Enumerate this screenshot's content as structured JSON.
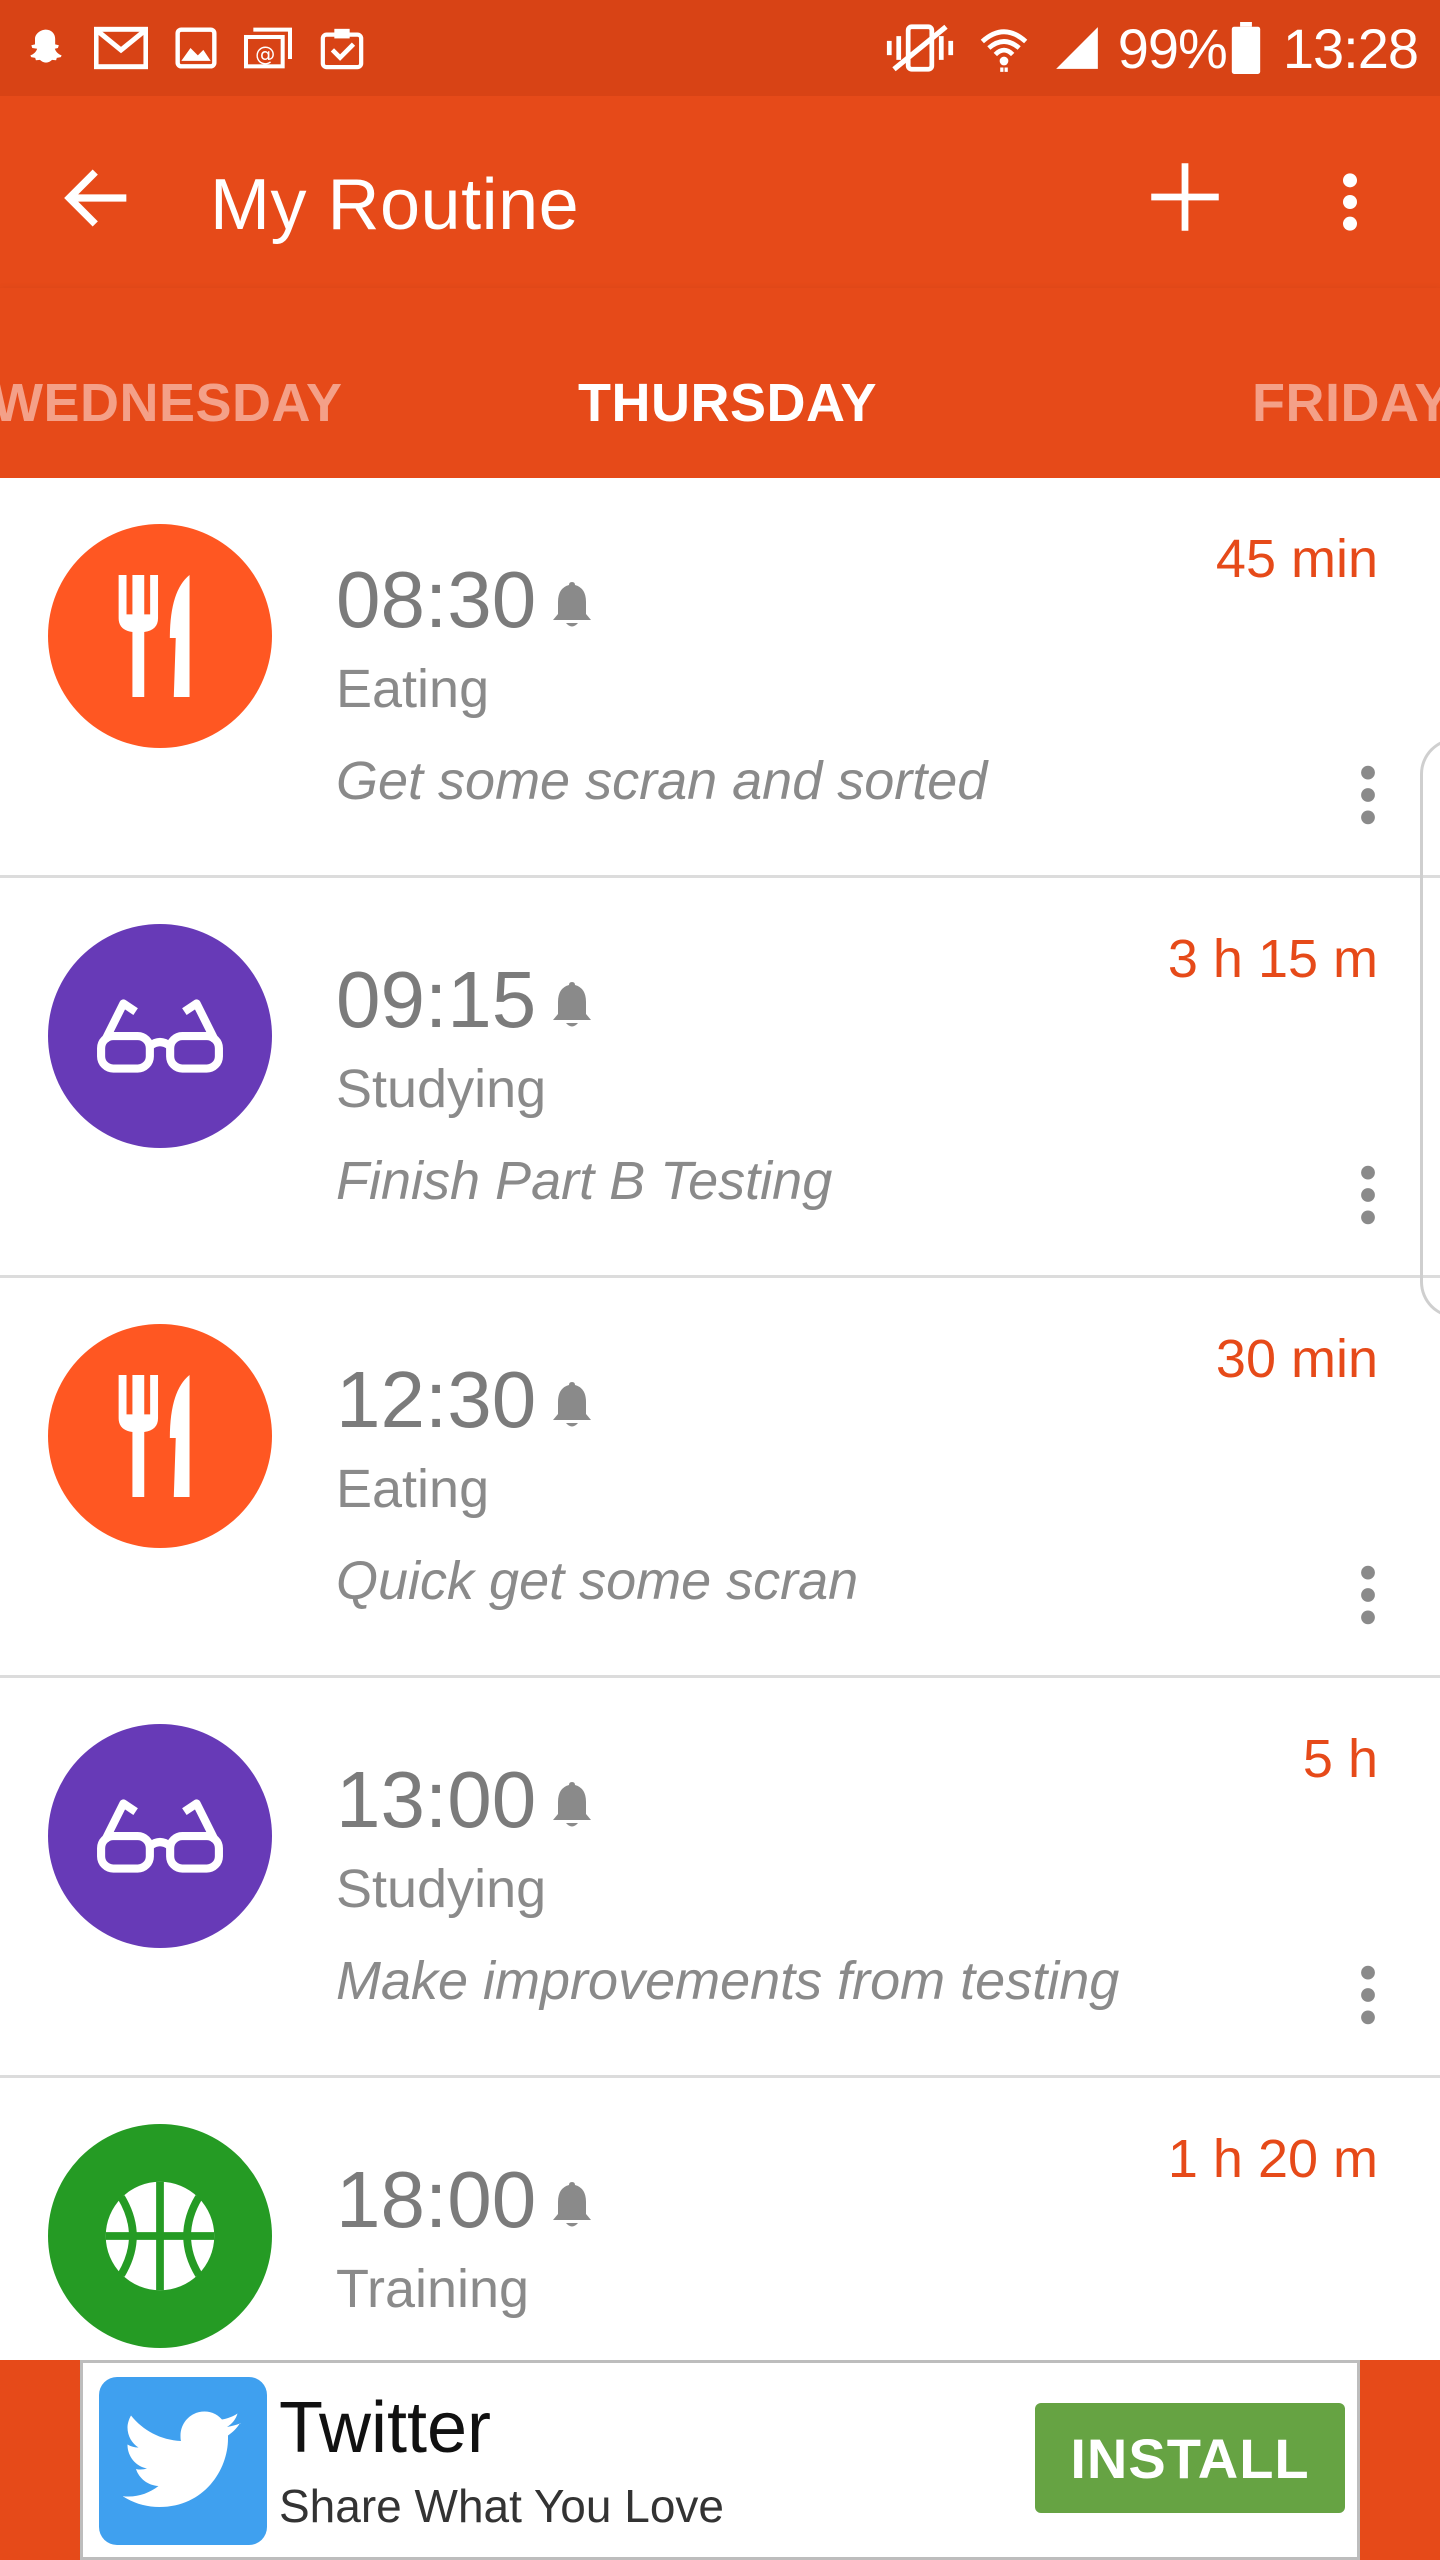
{
  "status_bar": {
    "battery_text": "99%",
    "time": "13:28",
    "left_icons": [
      "snapchat-icon",
      "gmail-icon",
      "gallery-icon",
      "email-icon",
      "clipboard-check-icon"
    ],
    "right_icons": [
      "mute-vibrate-icon",
      "wifi-icon",
      "signal-icon",
      "battery-icon"
    ]
  },
  "app_bar": {
    "title": "My Routine",
    "back_icon": "arrow-left-icon",
    "add_icon": "plus-icon",
    "more_icon": "more-vertical-icon"
  },
  "tabs": [
    {
      "label": "WEDNESDAY",
      "active": false
    },
    {
      "label": "THURSDAY",
      "active": true
    },
    {
      "label": "FRIDAY",
      "active": false
    }
  ],
  "routine_items": [
    {
      "time": "08:30",
      "category": "Eating",
      "note": "Get some scran and sorted",
      "duration": "45 min",
      "icon": "cutlery-icon",
      "color": "#ff5722"
    },
    {
      "time": "09:15",
      "category": "Studying",
      "note": "Finish Part B Testing",
      "duration": "3 h 15 m",
      "icon": "glasses-icon",
      "color": "#673ab7"
    },
    {
      "time": "12:30",
      "category": "Eating",
      "note": "Quick get some scran",
      "duration": "30 min",
      "icon": "cutlery-icon",
      "color": "#ff5722"
    },
    {
      "time": "13:00",
      "category": "Studying",
      "note": "Make improvements from testing",
      "duration": "5 h",
      "icon": "glasses-icon",
      "color": "#673ab7"
    },
    {
      "time": "18:00",
      "category": "Training",
      "note": "",
      "duration": "1 h 20 m",
      "icon": "basketball-icon",
      "color": "#259b24"
    }
  ],
  "ad": {
    "title": "Twitter",
    "subtitle": "Share What You Love",
    "button_label": "INSTALL",
    "logo_icon": "twitter-bird-icon",
    "button_color": "#66a343"
  },
  "colors": {
    "status_bar": "#d84315",
    "primary": "#e64a19",
    "accent_text": "#e64a19"
  }
}
